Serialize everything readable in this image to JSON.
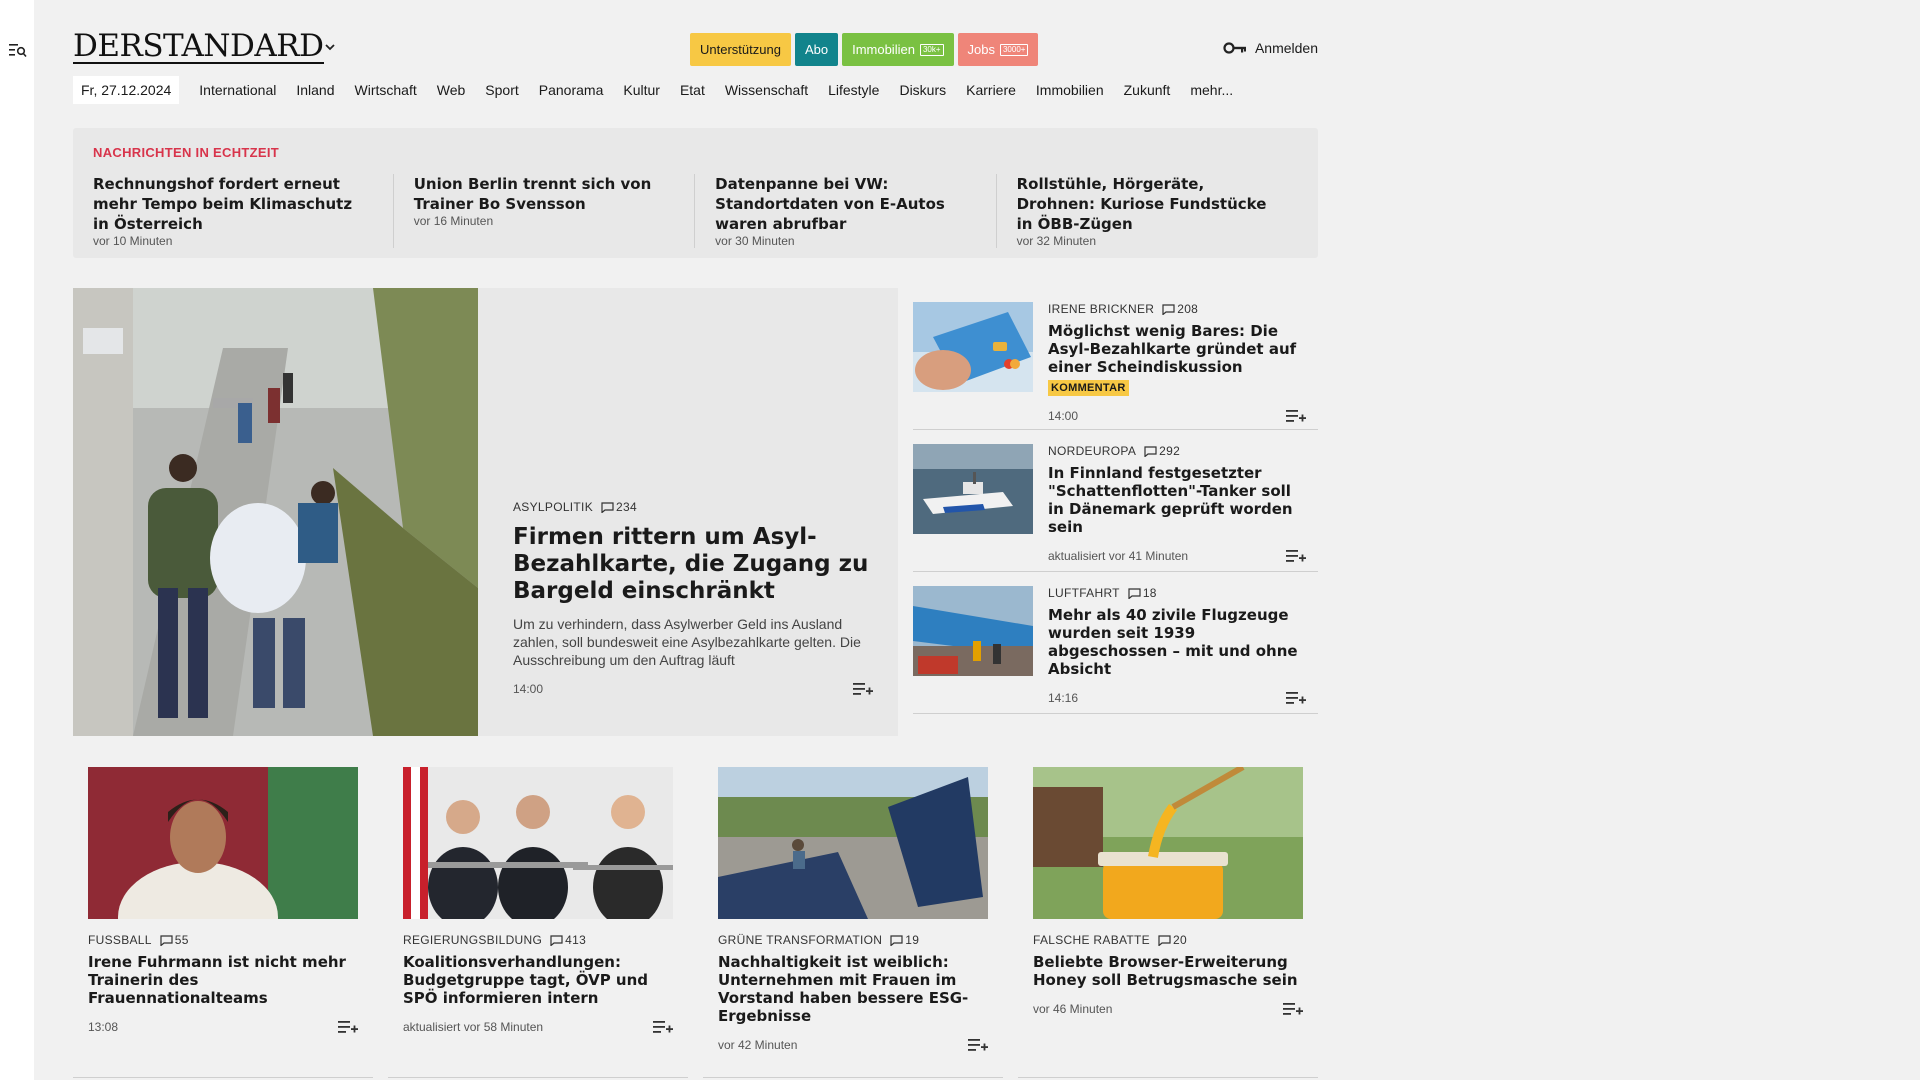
{
  "site": {
    "logo": "DERSTANDARD",
    "date": "Fr, 27.12.2024",
    "pills": {
      "support": "Unterstützung",
      "abo": "Abo",
      "immo": "Immobilien",
      "immo_badge": "30k+",
      "jobs": "Jobs",
      "jobs_badge": "3000+"
    },
    "login": "Anmelden",
    "nav": [
      "International",
      "Inland",
      "Wirtschaft",
      "Web",
      "Sport",
      "Panorama",
      "Kultur",
      "Etat",
      "Wissenschaft",
      "Lifestyle",
      "Diskurs",
      "Karriere",
      "Immobilien",
      "Zukunft",
      "mehr..."
    ]
  },
  "ticker": {
    "title": "NACHRICHTEN IN ECHTZEIT",
    "items": [
      {
        "head": "Rechnungshof fordert erneut mehr Tempo beim Klimaschutz in Österreich",
        "time": "vor 10 Minuten"
      },
      {
        "head": "Union Berlin trennt sich von Trainer Bo Svensson",
        "time": "vor 16 Minuten"
      },
      {
        "head": "Datenpanne bei VW: Standortdaten von E-Autos waren abrufbar",
        "time": "vor 30 Minuten"
      },
      {
        "head": "Rollstühle, Hörgeräte, Drohnen: Kuriose Fundstücke in ÖBB-Zügen",
        "time": "vor 32 Minuten"
      }
    ]
  },
  "lead": {
    "kicker": "ASYLPOLITIK",
    "comments": "234",
    "title": "Firmen rittern um Asyl-Bezahlkarte, die Zugang zu Bargeld einschränkt",
    "teaser": "Um zu verhindern, dass Asylwerber Geld ins Ausland zahlen, soll bundesweit eine Asylbezahlkarte gelten. Die Ausschreibung um den Auftrag läuft",
    "time": "14:00"
  },
  "side": [
    {
      "kicker": "IRENE BRICKNER",
      "comments": "208",
      "title": "Möglichst wenig Bares: Die Asyl-Bezahlkarte gründet auf einer Scheindiskussion",
      "label": "KOMMENTAR",
      "time": "14:00"
    },
    {
      "kicker": "NORDEUROPA",
      "comments": "292",
      "title": "In Finnland festgesetzter \"Schattenflotten\"-Tanker soll in Dänemark geprüft worden sein",
      "time": "aktualisiert vor 41 Minuten"
    },
    {
      "kicker": "LUFTFAHRT",
      "comments": "18",
      "title": "Mehr als 40 zivile Flugzeuge wurden seit 1939 abgeschossen – mit und ohne Absicht",
      "time": "14:16"
    }
  ],
  "cards": [
    {
      "kicker": "FUSSBALL",
      "comments": "55",
      "title": "Irene Fuhrmann ist nicht mehr Trainerin des Frauennationalteams",
      "time": "13:08"
    },
    {
      "kicker": "REGIERUNGSBILDUNG",
      "comments": "413",
      "title": "Koalitionsverhandlungen: Budgetgruppe tagt, ÖVP und SPÖ informieren intern",
      "time": "aktualisiert vor 58 Minuten"
    },
    {
      "kicker": "GRÜNE TRANSFORMATION",
      "comments": "19",
      "title": "Nachhaltigkeit ist weiblich: Unternehmen mit Frauen im Vorstand haben bessere ESG-Ergebnisse",
      "time": "vor 42 Minuten"
    },
    {
      "kicker": "FALSCHE RABATTE",
      "comments": "20",
      "title": "Beliebte Browser-Erweiterung Honey soll Betrugsmasche sein",
      "time": "vor 46 Minuten"
    }
  ]
}
